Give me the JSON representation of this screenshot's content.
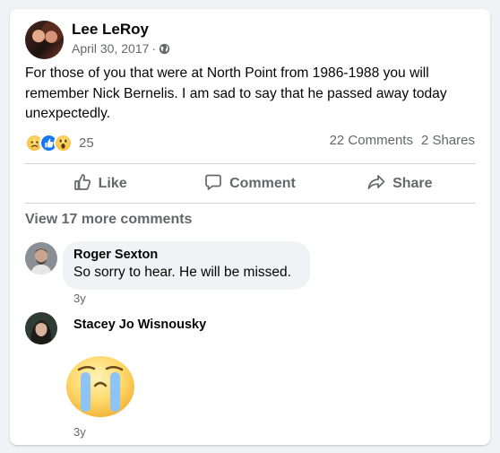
{
  "post": {
    "author": "Lee LeRoy",
    "date": "April 30, 2017",
    "separator": "·",
    "text": "For those of you that were at North Point from 1986-1988 you will remember Nick Bernelis.  I am sad to say that he passed away today unexpectedly.",
    "reaction_count": "25",
    "comments_count": "22 Comments",
    "shares_count": "2 Shares"
  },
  "actions": {
    "like": "Like",
    "comment": "Comment",
    "share": "Share"
  },
  "comments_section": {
    "view_more": "View 17 more comments",
    "comments": [
      {
        "author": "Roger Sexton",
        "text": "So sorry to hear. He will be missed.",
        "time": "3y"
      },
      {
        "author": "Stacey Jo Wisnousky",
        "sticker": "crying-face-sticker",
        "time": "3y"
      }
    ]
  },
  "colors": {
    "secondary_text": "#65676b",
    "like_blue": "#1877f2",
    "bubble_bg": "#f0f2f5"
  }
}
